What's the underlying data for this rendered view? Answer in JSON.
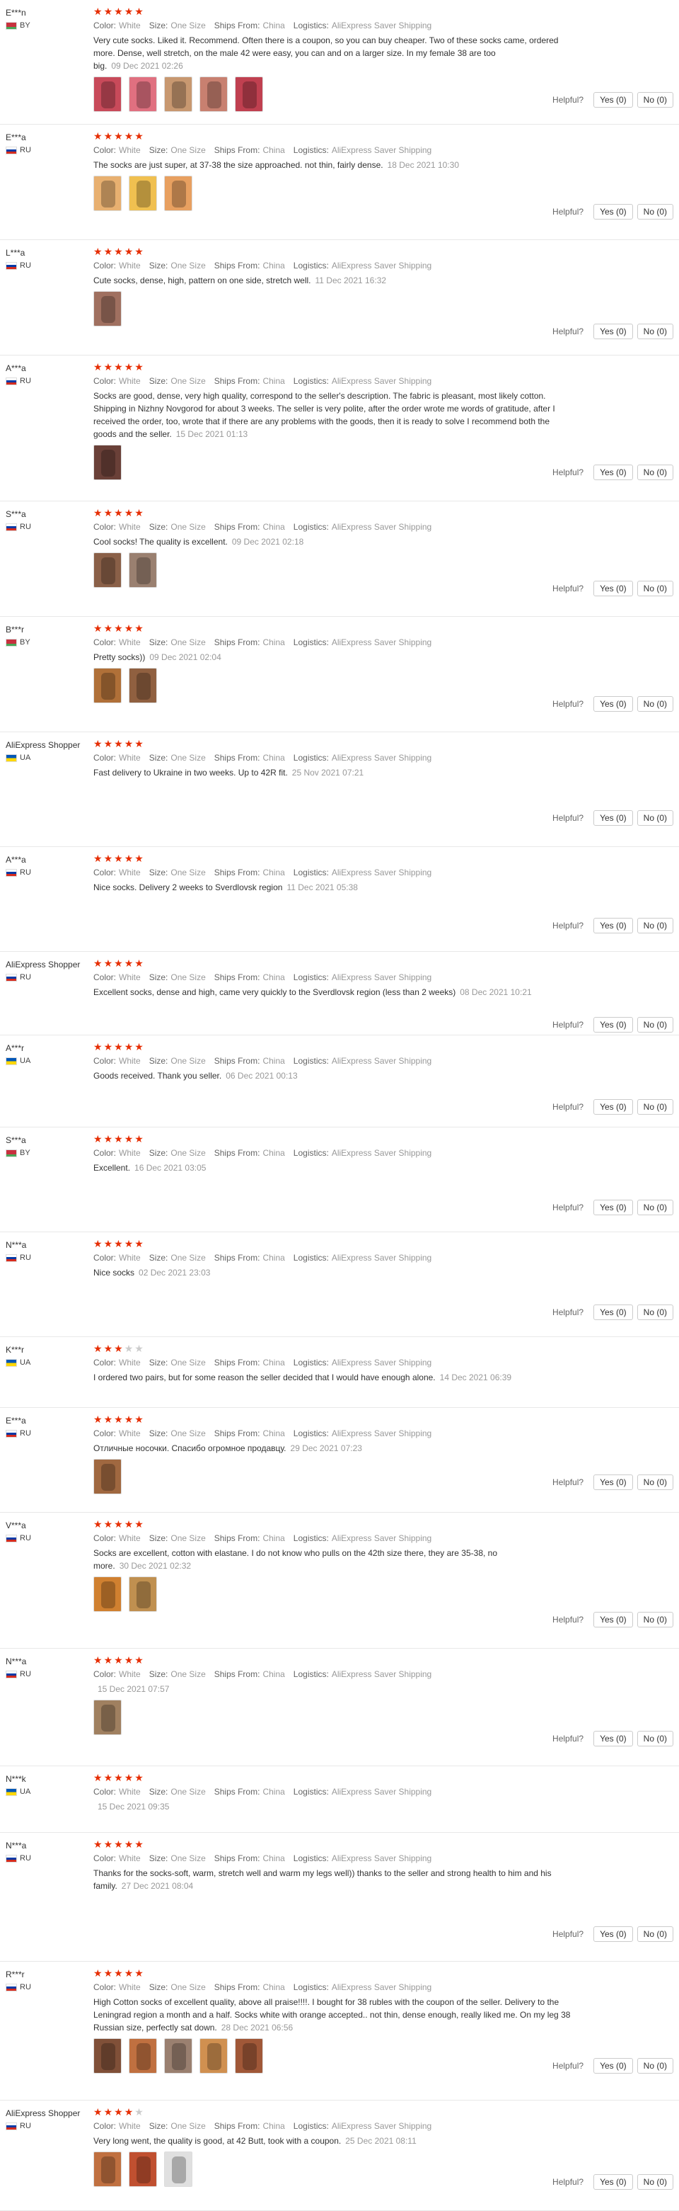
{
  "labels": {
    "color": "Color:",
    "size": "Size:",
    "ships_from": "Ships From:",
    "logistics": "Logistics:",
    "helpful": "Helpful?"
  },
  "reviews": [
    {
      "user": "E***n",
      "country": "BY",
      "stars": 5,
      "color": "White",
      "size": "One Size",
      "ships_from": "China",
      "logistics": "AliExpress Saver Shipping",
      "text": "Very cute socks. Liked it. Recommend. Often there is a coupon, so you can buy cheaper. Two of these socks came, ordered more. Dense, well stretch, on the male 42 were easy, you can and on a larger size. In my female 38 are too big.",
      "date": "09 Dec 2021 02:26",
      "photos": [
        "#c84a5a",
        "#e07080",
        "#c89870",
        "#c88070",
        "#c04050"
      ],
      "yes": "Yes (0)",
      "no": "No (0)"
    },
    {
      "user": "E***a",
      "country": "RU",
      "stars": 5,
      "color": "White",
      "size": "One Size",
      "ships_from": "China",
      "logistics": "AliExpress Saver Shipping",
      "text": "The socks are just super, at 37-38 the size approached. not thin, fairly dense.",
      "date": "18 Dec 2021 10:30",
      "photos": [
        "#e8b070",
        "#f0c050",
        "#e8a060"
      ],
      "yes": "Yes (0)",
      "no": "No (0)"
    },
    {
      "user": "L***a",
      "country": "RU",
      "stars": 5,
      "color": "White",
      "size": "One Size",
      "ships_from": "China",
      "logistics": "AliExpress Saver Shipping",
      "text": "Cute socks, dense, high, pattern on one side, stretch well.",
      "date": "11 Dec 2021 16:32",
      "photos": [
        "#a07060"
      ],
      "yes": "Yes (0)",
      "no": "No (0)"
    },
    {
      "user": "A***a",
      "country": "RU",
      "stars": 5,
      "color": "White",
      "size": "One Size",
      "ships_from": "China",
      "logistics": "AliExpress Saver Shipping",
      "text": "Socks are good, dense, very high quality, correspond to the seller's description. The fabric is pleasant, most likely cotton. Shipping in Nizhny Novgorod for about 3 weeks. The seller is very polite, after the order wrote me words of gratitude, after I received the order, too, wrote that if there are any problems with the goods, then it is ready to solve I recommend both the goods and the seller.",
      "date": "15 Dec 2021 01:13",
      "photos": [
        "#6a4038"
      ],
      "yes": "Yes (0)",
      "no": "No (0)"
    },
    {
      "user": "S***a",
      "country": "RU",
      "stars": 5,
      "color": "White",
      "size": "One Size",
      "ships_from": "China",
      "logistics": "AliExpress Saver Shipping",
      "text": "Cool socks! The quality is excellent.",
      "date": "09 Dec 2021 02:18",
      "photos": [
        "#8a6048",
        "#9a8070"
      ],
      "yes": "Yes (0)",
      "no": "No (0)"
    },
    {
      "user": "B***r",
      "country": "BY",
      "stars": 5,
      "color": "White",
      "size": "One Size",
      "ships_from": "China",
      "logistics": "AliExpress Saver Shipping",
      "text": "Pretty socks))",
      "date": "09 Dec 2021 02:04",
      "photos": [
        "#b07038",
        "#906040"
      ],
      "yes": "Yes (0)",
      "no": "No (0)"
    },
    {
      "user": "AliExpress Shopper",
      "country": "UA",
      "stars": 5,
      "color": "White",
      "size": "One Size",
      "ships_from": "China",
      "logistics": "AliExpress Saver Shipping",
      "text": "Fast delivery to Ukraine in two weeks. Up to 42R fit.",
      "date": "25 Nov 2021 07:21",
      "photos": [],
      "yes": "Yes (0)",
      "no": "No (0)"
    },
    {
      "user": "A***a",
      "country": "RU",
      "stars": 5,
      "color": "White",
      "size": "One Size",
      "ships_from": "China",
      "logistics": "AliExpress Saver Shipping",
      "text": "Nice socks. Delivery 2 weeks to Sverdlovsk region",
      "date": "11 Dec 2021 05:38",
      "photos": [],
      "yes": "Yes (0)",
      "no": "No (0)"
    },
    {
      "user": "AliExpress Shopper",
      "country": "RU",
      "stars": 5,
      "color": "White",
      "size": "One Size",
      "ships_from": "China",
      "logistics": "AliExpress Saver Shipping",
      "text": "Excellent socks, dense and high, came very quickly to the Sverdlovsk region (less than 2 weeks)",
      "date": "08 Dec 2021 10:21",
      "photos": [],
      "yes": "Yes (0)",
      "no": "No (0)"
    },
    {
      "user": "A***r",
      "country": "UA",
      "stars": 5,
      "color": "White",
      "size": "One Size",
      "ships_from": "China",
      "logistics": "AliExpress Saver Shipping",
      "text": "Goods received. Thank you seller.",
      "date": "06 Dec 2021 00:13",
      "photos": [],
      "yes": "Yes (0)",
      "no": "No (0)"
    },
    {
      "user": "S***a",
      "country": "BY",
      "stars": 5,
      "color": "White",
      "size": "One Size",
      "ships_from": "China",
      "logistics": "AliExpress Saver Shipping",
      "text": "Excellent.",
      "date": "16 Dec 2021 03:05",
      "photos": [],
      "yes": "Yes (0)",
      "no": "No (0)"
    },
    {
      "user": "N***a",
      "country": "RU",
      "stars": 5,
      "color": "White",
      "size": "One Size",
      "ships_from": "China",
      "logistics": "AliExpress Saver Shipping",
      "text": "Nice socks",
      "date": "02 Dec 2021 23:03",
      "photos": [],
      "yes": "Yes (0)",
      "no": "No (0)"
    },
    {
      "user": "K***r",
      "country": "UA",
      "stars": 3,
      "color": "White",
      "size": "One Size",
      "ships_from": "China",
      "logistics": "AliExpress Saver Shipping",
      "text": "I ordered two pairs, but for some reason the seller decided that I would have enough alone.",
      "date": "14 Dec 2021 06:39",
      "photos": [],
      "yes": "",
      "no": ""
    },
    {
      "user": "E***a",
      "country": "RU",
      "stars": 5,
      "color": "White",
      "size": "One Size",
      "ships_from": "China",
      "logistics": "AliExpress Saver Shipping",
      "text": "Отличные носочки. Спасибо огромное продавцу.",
      "date": "29 Dec 2021 07:23",
      "photos": [
        "#a06840"
      ],
      "yes": "Yes (0)",
      "no": "No (0)"
    },
    {
      "user": "V***a",
      "country": "RU",
      "stars": 5,
      "color": "White",
      "size": "One Size",
      "ships_from": "China",
      "logistics": "AliExpress Saver Shipping",
      "text": "Socks are excellent, cotton with elastane. I do not know who pulls on the 42th size there, they are 35-38, no more.",
      "date": "30 Dec 2021 02:32",
      "photos": [
        "#d08030",
        "#c09050"
      ],
      "yes": "Yes (0)",
      "no": "No (0)"
    },
    {
      "user": "N***a",
      "country": "RU",
      "stars": 5,
      "color": "White",
      "size": "One Size",
      "ships_from": "China",
      "logistics": "AliExpress Saver Shipping",
      "text": "",
      "date": "15 Dec 2021 07:57",
      "photos": [
        "#a08060"
      ],
      "yes": "Yes (0)",
      "no": "No (0)"
    },
    {
      "user": "N***k",
      "country": "UA",
      "stars": 5,
      "color": "White",
      "size": "One Size",
      "ships_from": "China",
      "logistics": "AliExpress Saver Shipping",
      "text": "",
      "date": "15 Dec 2021 09:35",
      "photos": [],
      "yes": "",
      "no": ""
    },
    {
      "user": "N***a",
      "country": "RU",
      "stars": 5,
      "color": "White",
      "size": "One Size",
      "ships_from": "China",
      "logistics": "AliExpress Saver Shipping",
      "text": "Thanks for the socks-soft, warm, stretch well and warm my legs well)) thanks to the seller and strong health to him and his family.",
      "date": "27 Dec 2021 08:04",
      "photos": [],
      "yes": "Yes (0)",
      "no": "No (0)"
    },
    {
      "user": "R***r",
      "country": "RU",
      "stars": 5,
      "color": "White",
      "size": "One Size",
      "ships_from": "China",
      "logistics": "AliExpress Saver Shipping",
      "text": "High Cotton socks of excellent quality, above all praise!!!!. I bought for 38 rubles with the coupon of the seller. Delivery to the Leningrad region a month and a half. Socks white with orange accepted.. not thin, dense enough, really liked me. On my leg 38 Russian size, perfectly sat down.",
      "date": "28 Dec 2021 06:56",
      "photos": [
        "#805038",
        "#c07040",
        "#9a8070",
        "#d09050",
        "#a05838"
      ],
      "yes": "Yes (0)",
      "no": "No (0)"
    },
    {
      "user": "AliExpress Shopper",
      "country": "RU",
      "stars": 4,
      "color": "White",
      "size": "One Size",
      "ships_from": "China",
      "logistics": "AliExpress Saver Shipping",
      "text": "Very long went, the quality is good, at 42 Butt, took with a coupon.",
      "date": "25 Dec 2021 08:11",
      "photos": [
        "#c07040",
        "#c05030",
        "#e0e0e0"
      ],
      "yes": "Yes (0)",
      "no": "No (0)"
    }
  ]
}
